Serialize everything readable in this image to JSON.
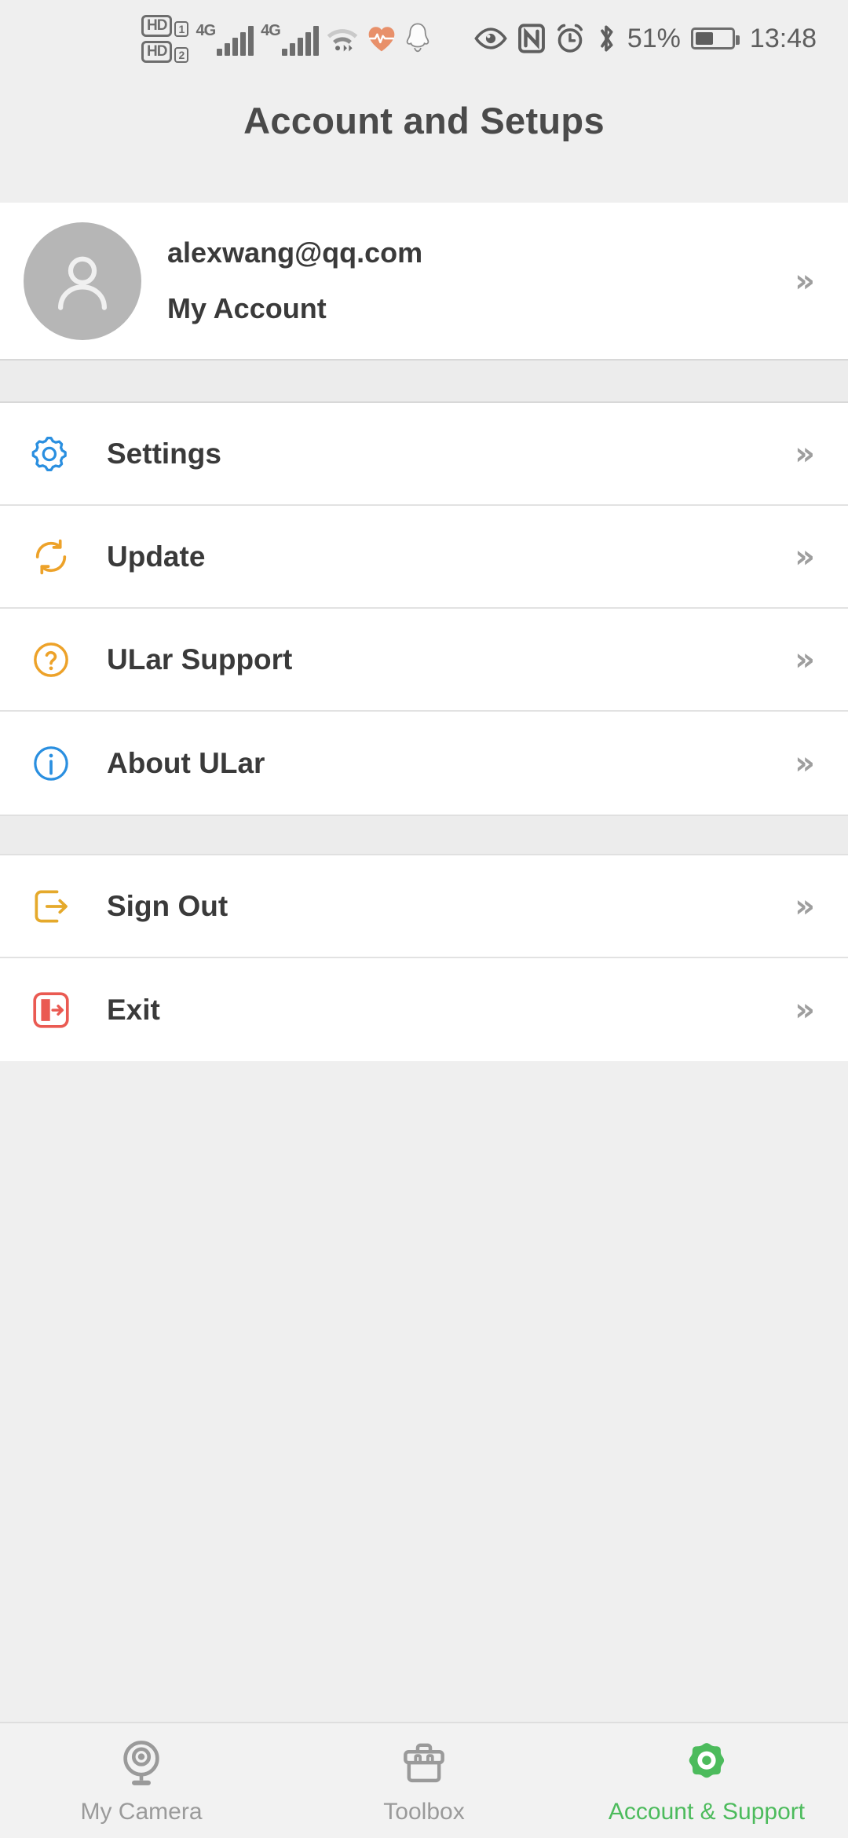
{
  "statusbar": {
    "volte": [
      {
        "label": "HD",
        "sim": "1"
      },
      {
        "label": "HD",
        "sim": "2"
      }
    ],
    "network_1": "4G",
    "network_2": "4G",
    "icons_left": [
      "wifi-icon",
      "heart-rate-icon",
      "qq-penguin-icon"
    ],
    "icons_right": [
      "eye-icon",
      "nfc-icon",
      "alarm-clock-icon",
      "bluetooth-icon"
    ],
    "battery_percent": "51%",
    "battery_level": 51,
    "time": "13:48"
  },
  "header": {
    "title": "Account and Setups"
  },
  "account": {
    "avatar_icon": "person-avatar-icon",
    "email": "alexwang@qq.com",
    "subtitle": "My Account",
    "chevron": "»"
  },
  "menu_groups": [
    {
      "items": [
        {
          "label": "Settings",
          "icon": "gear-icon",
          "color": "#2a8fe0",
          "chevron": "»"
        },
        {
          "label": "Update",
          "icon": "refresh-icon",
          "color": "#eda229",
          "chevron": "»"
        },
        {
          "label": "ULar Support",
          "icon": "question-mark-icon",
          "color": "#eda229",
          "chevron": "»"
        },
        {
          "label": "About ULar",
          "icon": "info-icon",
          "color": "#2a8fe0",
          "chevron": "»"
        }
      ]
    },
    {
      "items": [
        {
          "label": "Sign Out",
          "icon": "sign-out-icon",
          "color": "#e5a92b",
          "chevron": "»"
        },
        {
          "label": "Exit",
          "icon": "exit-door-icon",
          "color": "#ea5a52",
          "chevron": "»"
        }
      ]
    }
  ],
  "bottom_nav": {
    "active_color": "#4cbb5c",
    "inactive_color": "#9a9a9a",
    "items": [
      {
        "label": "My Camera",
        "icon": "webcam-icon",
        "active": false
      },
      {
        "label": "Toolbox",
        "icon": "toolbox-icon",
        "active": false
      },
      {
        "label": "Account & Support",
        "icon": "gear-icon",
        "active": true
      }
    ]
  }
}
